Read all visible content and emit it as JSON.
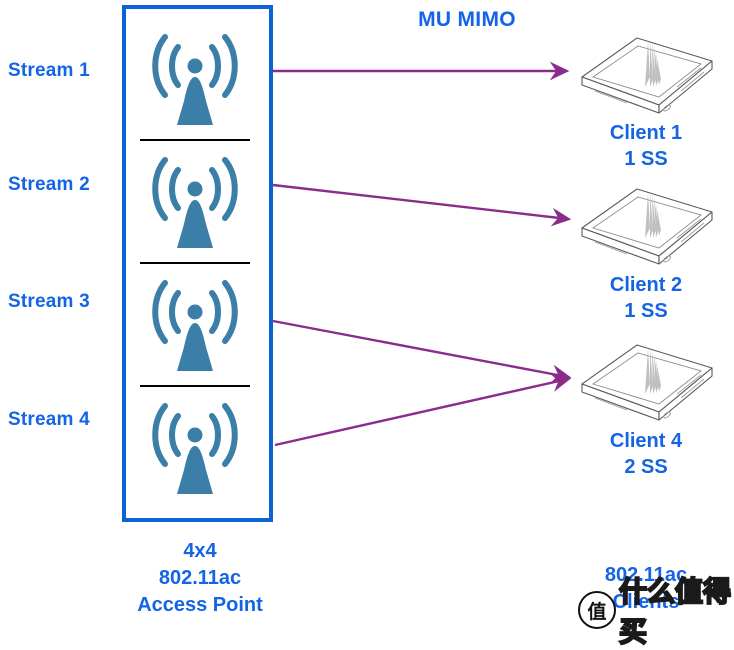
{
  "diagram": {
    "title_annotation": "MU MIMO",
    "accent_blue": "#1464e6",
    "box_blue": "#0b63d6",
    "arrow_purple": "#8b2c8b",
    "antenna_blue": "#3b7ea8"
  },
  "access_point": {
    "streams": [
      {
        "label": "Stream 1",
        "icon": "wifi-antenna-icon"
      },
      {
        "label": "Stream 2",
        "icon": "wifi-antenna-icon"
      },
      {
        "label": "Stream 3",
        "icon": "wifi-antenna-icon"
      },
      {
        "label": "Stream 4",
        "icon": "wifi-antenna-icon"
      }
    ],
    "caption": "4x4\n802.11ac\nAccess Point"
  },
  "clients": [
    {
      "name": "Client 1",
      "spatial_streams": "1 SS",
      "caption": "Client 1\n1 SS",
      "icon": "tablet-icon"
    },
    {
      "name": "Client 2",
      "spatial_streams": "1 SS",
      "caption": "Client 2\n1 SS",
      "icon": "tablet-icon"
    },
    {
      "name": "Client 4",
      "spatial_streams": "2 SS",
      "caption": "Client 4\n2 SS",
      "icon": "tablet-icon"
    }
  ],
  "clients_caption": "802.11ac\nClients",
  "links": [
    {
      "from": "Stream 1",
      "to": "Client 1"
    },
    {
      "from": "Stream 2",
      "to": "Client 2"
    },
    {
      "from": "Stream 3",
      "to": "Client 4"
    },
    {
      "from": "Stream 4",
      "to": "Client 4"
    }
  ],
  "watermark": {
    "badge": "值",
    "text": "什么值得买"
  }
}
